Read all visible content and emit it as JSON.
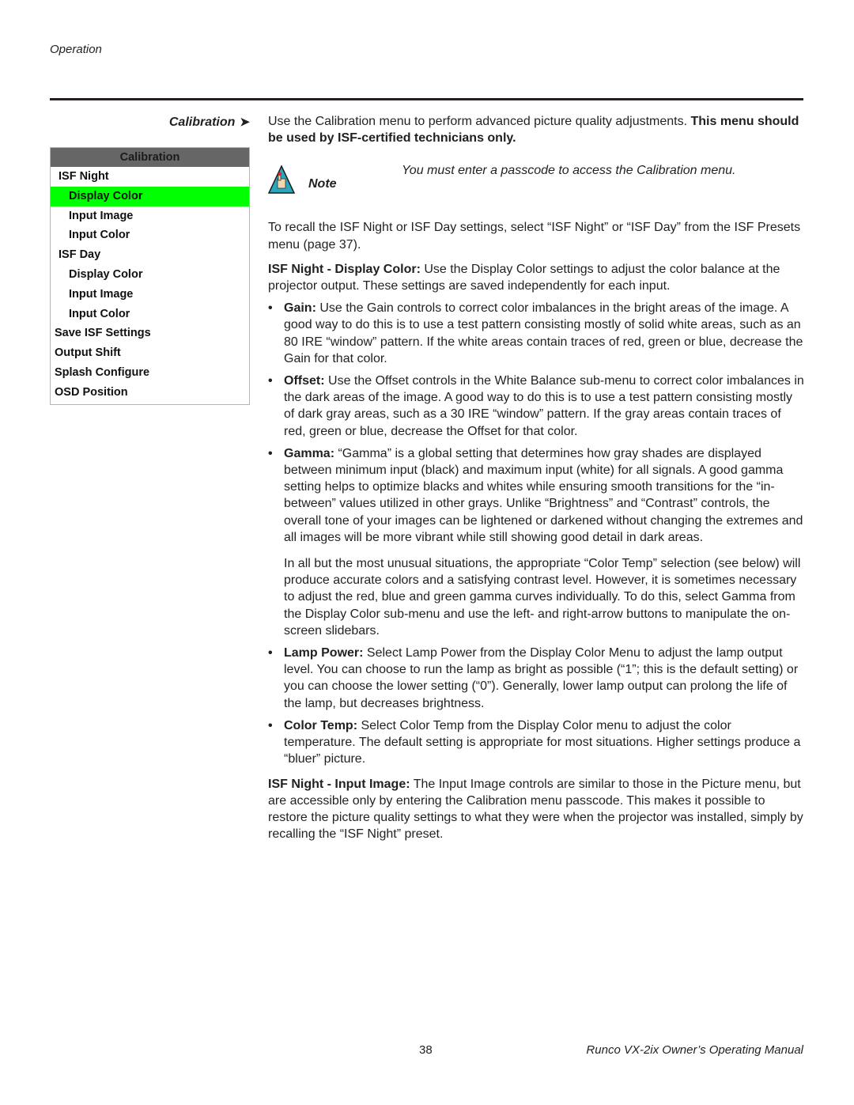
{
  "header": {
    "section": "Operation"
  },
  "side_heading": {
    "label": "Calibration",
    "arrow_icon": "arrow-right-icon"
  },
  "menu": {
    "title": "Calibration",
    "items": [
      {
        "label": "ISF Night",
        "level": 0,
        "active": false
      },
      {
        "label": "Display Color",
        "level": 1,
        "active": true
      },
      {
        "label": "Input Image",
        "level": 1,
        "active": false
      },
      {
        "label": "Input Color",
        "level": 1,
        "active": false
      },
      {
        "label": "ISF Day",
        "level": 0,
        "active": false
      },
      {
        "label": "Display Color",
        "level": 1,
        "active": false
      },
      {
        "label": "Input Image",
        "level": 1,
        "active": false
      },
      {
        "label": "Input Color",
        "level": 1,
        "active": false
      },
      {
        "label": "Save ISF Settings",
        "level": -1,
        "active": false
      },
      {
        "label": "Output Shift",
        "level": -1,
        "active": false
      },
      {
        "label": "Splash Configure",
        "level": -1,
        "active": false
      },
      {
        "label": "OSD Position",
        "level": -1,
        "active": false
      }
    ],
    "active_color": "#00ff00",
    "title_bg": "#666666"
  },
  "intro": {
    "text": "Use the Calibration menu to perform advanced picture quality adjustments. ",
    "bold": "This menu should be used by ISF-certified technicians only."
  },
  "note": {
    "label": "Note",
    "text": "You must enter a passcode to access the Calibration menu."
  },
  "recall": "To recall the ISF Night or ISF Day settings, select “ISF Night” or “ISF Day” from the ISF Presets menu (page 37).",
  "display_color": {
    "heading": "ISF Night - Display Color:",
    "text": " Use the Display Color settings to adjust the color balance at the projector output. These settings are saved independently for each input."
  },
  "bullets": [
    {
      "term": "Gain:",
      "text": " Use the Gain controls to correct color imbalances in the bright areas of the image. A good way to do this is to use a test pattern consisting mostly of solid white areas, such as an 80 IRE “window” pattern. If the white areas contain traces of red, green or blue, decrease the Gain for that color."
    },
    {
      "term": "Offset:",
      "text": " Use the Offset controls in the White Balance sub-menu to correct color imbalances in the dark areas of the image. A good way to do this is to use a test pattern consisting mostly of dark gray areas, such as a 30 IRE “window” pattern. If the gray areas contain traces of red, green or blue, decrease the Offset for that color."
    },
    {
      "term": "Gamma:",
      "text": " “Gamma” is a global setting that determines how gray shades are displayed between minimum input (black) and maximum input (white) for all signals. A good gamma setting helps to optimize blacks and whites while ensuring smooth transitions for the “in-between” values utilized in other grays. Unlike “Brightness” and “Contrast” controls, the overall tone of your images can be lightened or darkened without changing the extremes and all images will be more vibrant while still showing good detail in dark areas."
    }
  ],
  "gamma_followup": "In all but the most unusual situations, the appropriate “Color Temp” selection (see below) will produce accurate colors and a satisfying contrast level. However, it is sometimes necessary to adjust the red, blue and green gamma curves individually. To do this, select Gamma from the Display Color sub-menu and use the left- and right-arrow buttons to manipulate the on-screen slidebars.",
  "bullets2": [
    {
      "term": "Lamp Power:",
      "text": " Select Lamp Power from the Display Color Menu to adjust the lamp output level. You can choose to run the lamp as bright as possible (“1”; this is the default setting) or you can choose the lower setting (“0”). Generally, lower lamp output can prolong the life of the lamp, but decreases brightness."
    },
    {
      "term": "Color Temp:",
      "text": " Select Color Temp from the Display Color menu to adjust the color temperature. The default setting is appropriate for most situations. Higher settings produce a “bluer” picture."
    }
  ],
  "input_image": {
    "heading": "ISF Night - Input Image:",
    "text": " The Input Image controls are similar to those in the Picture menu, but are accessible only by entering the Calibration menu passcode. This makes it possible to restore the picture quality settings to what they were when the projector was installed, simply by recalling the “ISF Night” preset."
  },
  "footer": {
    "page_number": "38",
    "manual_title": "Runco VX-2ix Owner’s Operating Manual"
  }
}
